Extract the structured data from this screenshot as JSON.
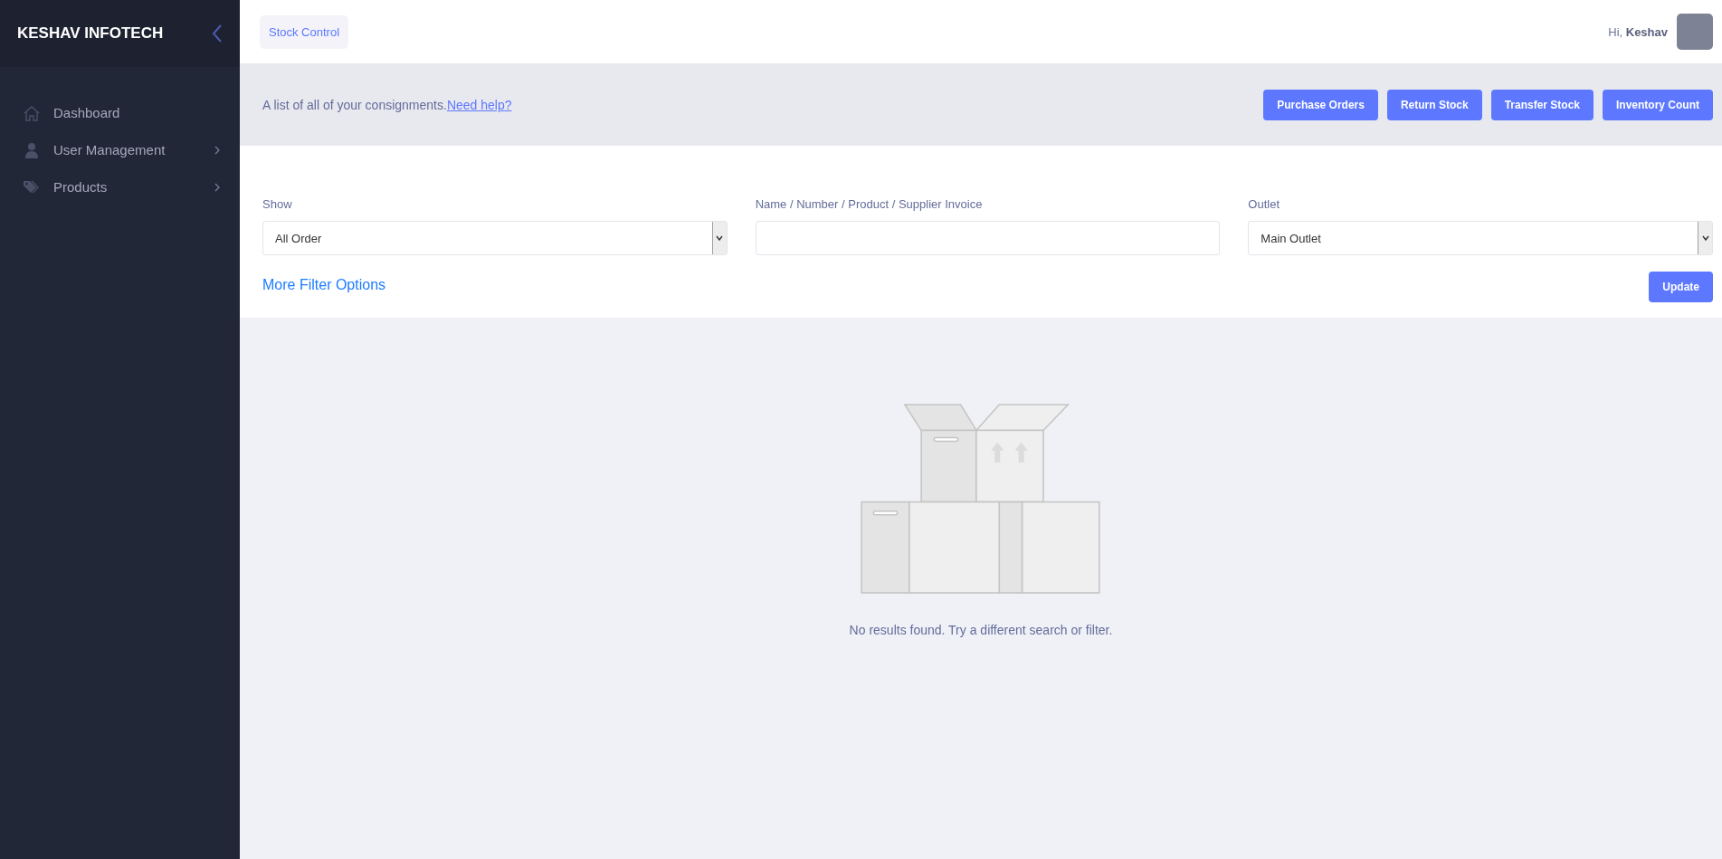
{
  "sidebar": {
    "brand": "KESHAV INFOTECH",
    "items": [
      {
        "label": "Dashboard",
        "kind": "link",
        "selected": false
      },
      {
        "label": "User Management",
        "kind": "menu",
        "selected": false
      },
      {
        "label": "Products",
        "kind": "menu",
        "selected": false
      }
    ]
  },
  "topbar": {
    "tab": "Stock Control",
    "greeting": "Hi,",
    "user": "Keshav"
  },
  "header": {
    "text": "A list of all of your consignments.",
    "help_link": "Need help?",
    "buttons": [
      "Purchase Orders",
      "Return Stock",
      "Transfer Stock",
      "Inventory Count"
    ]
  },
  "filters": {
    "fields": [
      {
        "label": "Show",
        "kind": "select",
        "value": "All Order"
      },
      {
        "label": "Name / Number / Product / Supplier Invoice",
        "kind": "text"
      },
      {
        "label": "Outlet",
        "kind": "select",
        "value": "Main Outlet"
      }
    ],
    "more_link": "More Filter Options",
    "update_button": "Update"
  },
  "empty_state": {
    "message": "No results found. Try a different search or filter."
  }
}
